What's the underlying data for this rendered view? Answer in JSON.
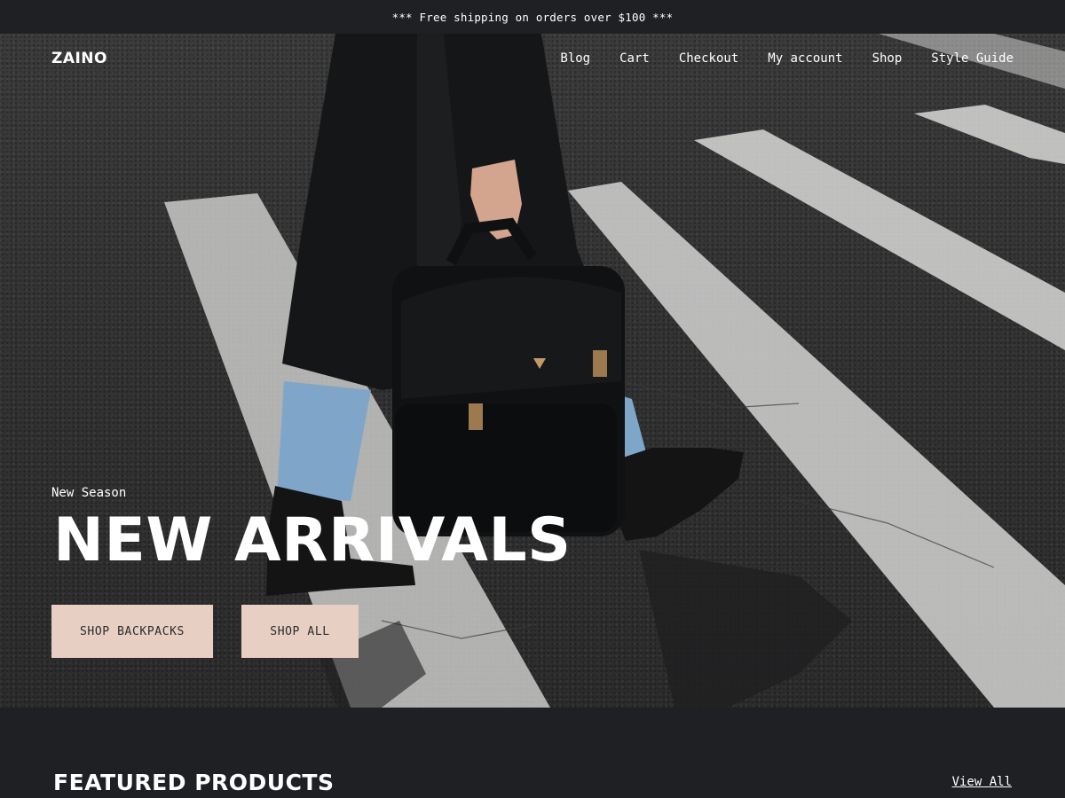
{
  "announcement": {
    "text": "*** Free shipping on orders over $100 ***"
  },
  "header": {
    "logo": "ZAINO",
    "nav": [
      "Blog",
      "Cart",
      "Checkout",
      "My account",
      "Shop",
      "Style Guide"
    ]
  },
  "hero": {
    "eyebrow": "New Season",
    "headline": "NEW ARRIVALS",
    "buttons": [
      "SHOP BACKPACKS",
      "SHOP ALL"
    ]
  },
  "featured": {
    "title": "FEATURED PRODUCTS",
    "view_all": "View All"
  },
  "colors": {
    "page_background": "#1f2024",
    "button_background": "#e8cfc4",
    "button_text": "#2b2b2b",
    "text": "#ffffff"
  }
}
